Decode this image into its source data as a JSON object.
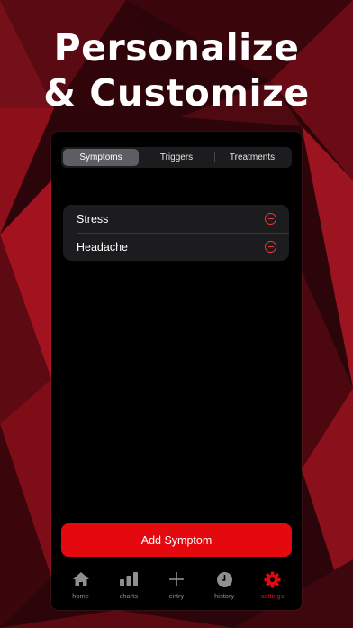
{
  "headline": {
    "line1": "Personalize",
    "line2": "& Customize"
  },
  "segments": [
    {
      "label": "Symptoms",
      "active": true
    },
    {
      "label": "Triggers",
      "active": false
    },
    {
      "label": "Treatments",
      "active": false
    }
  ],
  "items": [
    {
      "label": "Stress"
    },
    {
      "label": "Headache"
    }
  ],
  "add_button": {
    "label": "Add Symptom"
  },
  "tabs": [
    {
      "label": "home",
      "icon": "house-icon"
    },
    {
      "label": "charts",
      "icon": "bar-chart-icon"
    },
    {
      "label": "entry",
      "icon": "plus-icon"
    },
    {
      "label": "history",
      "icon": "clock-icon"
    },
    {
      "label": "settings",
      "icon": "gear-icon",
      "active": true
    }
  ],
  "colors": {
    "accent": "#e3090f",
    "background_red": "#7a0a14",
    "panel": "#000000",
    "row_bg": "#1c1c1e",
    "tab_inactive": "#8e8e93"
  }
}
